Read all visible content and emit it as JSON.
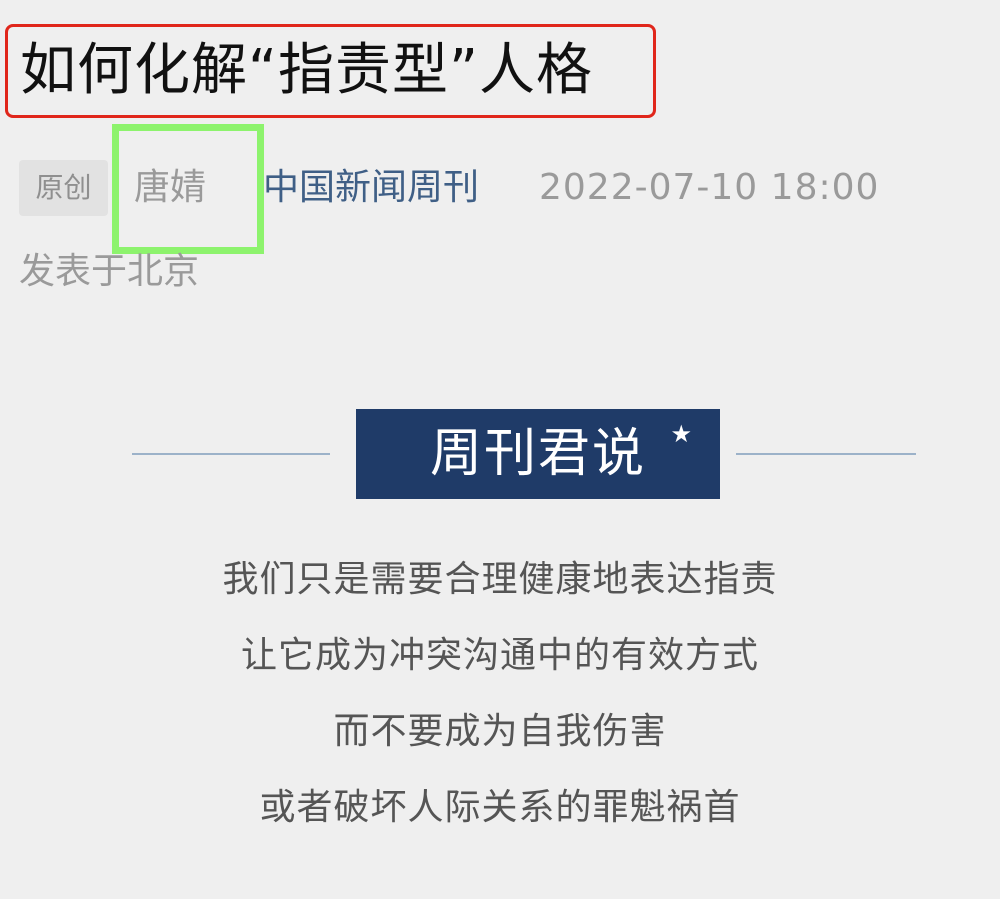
{
  "article": {
    "title": "如何化解“指责型”人格",
    "tag": "原创",
    "author": "唐婧",
    "source": "中国新闻周刊",
    "datetime": "2022-07-10 18:00",
    "location": "发表于北京"
  },
  "banner": {
    "label": "周刊君说",
    "star": "★"
  },
  "quote": {
    "lines": [
      "我们只是需要合理健康地表达指责",
      "让它成为冲突沟通中的有效方式",
      "而不要成为自我伤害",
      "或者破坏人际关系的罪魁祸首"
    ]
  },
  "annotations": {
    "title_box_color": "#e0261b",
    "author_box_color": "#8df36d"
  },
  "colors": {
    "background": "#efefef",
    "source_blue": "#3f5f86",
    "banner_bg": "#1f3b68",
    "muted_text": "#9a9a9a"
  }
}
